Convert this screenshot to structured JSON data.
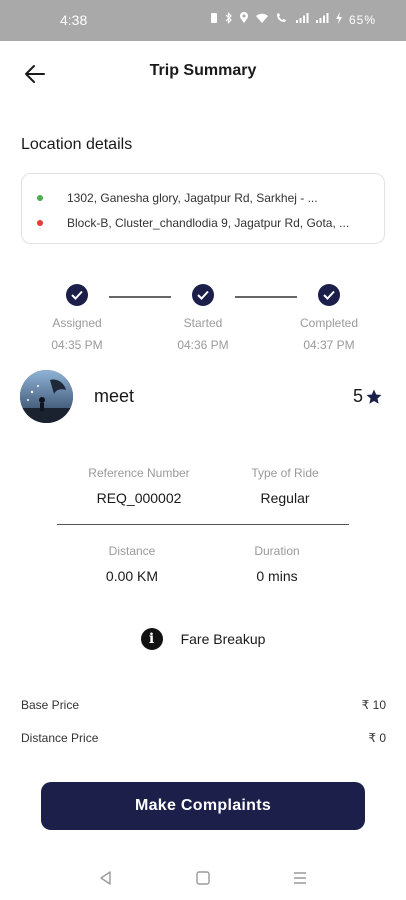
{
  "status_bar": {
    "time": "4:38",
    "battery": "65%",
    "icons": [
      "vibrate-icon",
      "bluetooth-icon",
      "location-icon",
      "wifi-icon",
      "wifi-call-icon",
      "signal-icon",
      "signal-icon",
      "charging-icon"
    ]
  },
  "header": {
    "title": "Trip Summary"
  },
  "location": {
    "section_title": "Location details",
    "pickup": "1302, Ganesha glory, Jagatpur Rd, Sarkhej - ...",
    "drop": "Block-B, Cluster_chandlodia 9, Jagatpur Rd, Gota, ..."
  },
  "timeline": [
    {
      "label": "Assigned",
      "time": "04:35 PM"
    },
    {
      "label": "Started",
      "time": "04:36 PM"
    },
    {
      "label": "Completed",
      "time": "04:37 PM"
    }
  ],
  "driver": {
    "name": "meet",
    "rating": "5"
  },
  "trip_info": {
    "reference_label": "Reference Number",
    "reference_value": "REQ_000002",
    "ride_type_label": "Type of Ride",
    "ride_type_value": "Regular",
    "distance_label": "Distance",
    "distance_value": "0.00 KM",
    "duration_label": "Duration",
    "duration_value": "0 mins"
  },
  "fare": {
    "title": "Fare Breakup",
    "rows": [
      {
        "label": "Base Price",
        "value": "₹ 10"
      },
      {
        "label": "Distance Price",
        "value": "₹ 0"
      }
    ]
  },
  "actions": {
    "complaint_label": "Make Complaints"
  },
  "colors": {
    "primary": "#1b1f4a",
    "pickup_dot": "#4caf50",
    "drop_dot": "#e53935",
    "muted_text": "#9a9a9a"
  }
}
